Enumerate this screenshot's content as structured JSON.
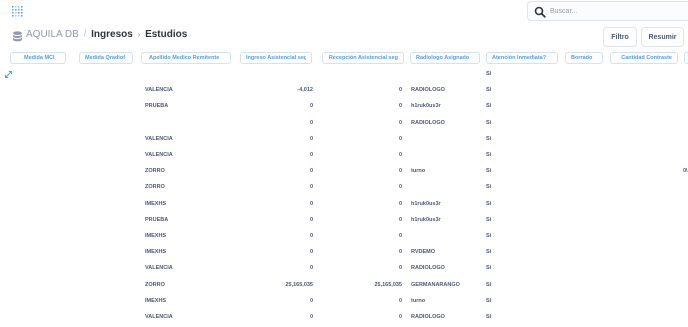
{
  "search": {
    "placeholder": "Buscar..."
  },
  "breadcrumb": {
    "database": "AQUILA DB",
    "separator": "/",
    "table": "Ingresos",
    "question": "Estudios"
  },
  "actions": {
    "filter": "Filtro",
    "summarize": "Resumir"
  },
  "columns": [
    "Medida MCI",
    "Medida Qradiof",
    "Apellido Medico Remitente",
    "Ingreso Asistencial seg",
    "Recepción Asistencial seg",
    "Radiologo Asignado",
    "Atención Inmediata?",
    "Borrado",
    "Cantidad Contraste"
  ],
  "rows": [
    {
      "medico": "",
      "ingreso": "",
      "recepcion": "",
      "radiologo": "",
      "atencion": "Si",
      "extra": ""
    },
    {
      "medico": "VALENCIA",
      "ingreso": "-4,012",
      "recepcion": "0",
      "radiologo": "RADIOLOGO",
      "atencion": "Si",
      "extra": ""
    },
    {
      "medico": "PRUEBA",
      "ingreso": "0",
      "recepcion": "0",
      "radiologo": "h1ruk0us3r",
      "atencion": "Si",
      "extra": ""
    },
    {
      "medico": "",
      "ingreso": "0",
      "recepcion": "0",
      "radiologo": "RADIOLOGO",
      "atencion": "Si",
      "extra": ""
    },
    {
      "medico": "VALENCIA",
      "ingreso": "0",
      "recepcion": "0",
      "radiologo": "",
      "atencion": "Si",
      "extra": ""
    },
    {
      "medico": "VALENCIA",
      "ingreso": "0",
      "recepcion": "0",
      "radiologo": "",
      "atencion": "Si",
      "extra": ""
    },
    {
      "medico": "ZORRO",
      "ingreso": "0",
      "recepcion": "0",
      "radiologo": "turno",
      "atencion": "Si",
      "extra": "0\\"
    },
    {
      "medico": "ZORRO",
      "ingreso": "0",
      "recepcion": "0",
      "radiologo": "",
      "atencion": "Si",
      "extra": ""
    },
    {
      "medico": "IMEXHS",
      "ingreso": "0",
      "recepcion": "0",
      "radiologo": "h1ruk0us3r",
      "atencion": "Si",
      "extra": ""
    },
    {
      "medico": "PRUEBA",
      "ingreso": "0",
      "recepcion": "0",
      "radiologo": "h1ruk0us3r",
      "atencion": "Si",
      "extra": ""
    },
    {
      "medico": "IMEXHS",
      "ingreso": "0",
      "recepcion": "0",
      "radiologo": "",
      "atencion": "Si",
      "extra": ""
    },
    {
      "medico": "IMEXHS",
      "ingreso": "0",
      "recepcion": "0",
      "radiologo": "RVDEMO",
      "atencion": "Si",
      "extra": ""
    },
    {
      "medico": "VALENCIA",
      "ingreso": "0",
      "recepcion": "0",
      "radiologo": "RADIOLOGO",
      "atencion": "Si",
      "extra": ""
    },
    {
      "medico": "ZORRO",
      "ingreso": "25,165,035",
      "recepcion": "25,165,035",
      "radiologo": "GERMANARANGO",
      "atencion": "Si",
      "extra": ""
    },
    {
      "medico": "IMEXHS",
      "ingreso": "0",
      "recepcion": "0",
      "radiologo": "turno",
      "atencion": "Si",
      "extra": ""
    },
    {
      "medico": "VALENCIA",
      "ingreso": "0",
      "recepcion": "0",
      "radiologo": "RADIOLOGO",
      "atencion": "Si",
      "extra": ""
    }
  ],
  "colors": {
    "accent": "#509ee3",
    "text": "#4c5773",
    "muted": "#949aab",
    "border": "#dfe4ea"
  },
  "icons": {
    "logo": "metabase-logo",
    "search": "search-icon",
    "database": "database-icon",
    "expand": "expand-icon"
  }
}
